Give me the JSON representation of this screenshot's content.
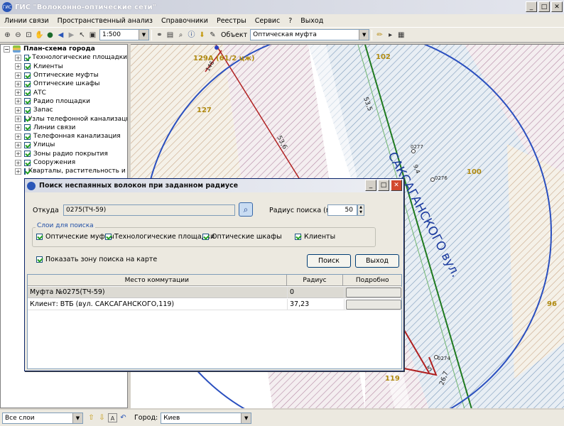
{
  "window": {
    "title": "ГИС \"Волоконно-оптические сети\"",
    "app_icon": "gis"
  },
  "menu": [
    "Линии связи",
    "Пространственный анализ",
    "Справочники",
    "Реестры",
    "Сервис",
    "?",
    "Выход"
  ],
  "toolbar": {
    "scale_value": "1:500",
    "object_label": "Объект",
    "object_value": "Оптическая муфта"
  },
  "tree": {
    "root": "План-схема города",
    "items": [
      "Технологические площадки",
      "Клиенты",
      "Оптические муфты",
      "Оптические шкафы",
      "АТС",
      "Радио площадки",
      "Запас",
      "Узлы телефонной канализации",
      "Линии связи",
      "Телефонная канализация",
      "Улицы",
      "Зоны радио покрытия",
      "Сооружения",
      "Кварталы, растительность и во"
    ]
  },
  "map": {
    "street_label": "САКСАГАНСКОГО вул.",
    "labels": [
      "129А (61/2 цж)",
      "102",
      "127",
      "100",
      "96",
      "119"
    ],
    "line_labels": [
      "53,5",
      "53,6",
      "9,4",
      "5",
      "26,7",
      "146"
    ],
    "nodes": [
      "0277",
      "0276",
      "0274"
    ]
  },
  "dialog": {
    "title": "Поиск неспаянных волокон при заданном радиусе",
    "from_label": "Откуда",
    "from_value": "0275(ТЧ-59)",
    "radius_label": "Радиус поиска (м)",
    "radius_value": "50",
    "layers_caption": "Слои для поиска",
    "layers": [
      "Оптические муфты",
      "Технологические площадки",
      "Оптические шкафы",
      "Клиенты"
    ],
    "show_zone_label": "Показать зону поиска на карте",
    "search_button": "Поиск",
    "exit_button": "Выход",
    "grid": {
      "columns": [
        "Место коммутации",
        "Радиус",
        "Подробно"
      ],
      "rows": [
        {
          "place": "Муфта №0275(ТЧ-59)",
          "radius": "0"
        },
        {
          "place": "Клиент: ВТБ (вул. САКСАГАНСКОГО,119)",
          "radius": "37,23"
        }
      ]
    }
  },
  "status": {
    "layers_value": "Все слои",
    "city_label": "Город:",
    "city_value": "Киев"
  }
}
